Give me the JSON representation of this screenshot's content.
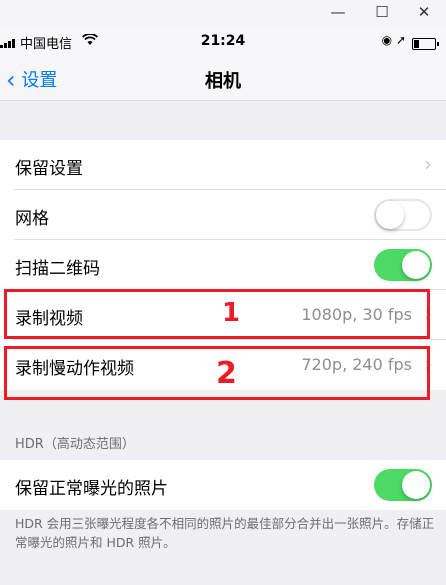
{
  "window": {
    "minimize": "—",
    "maximize": "☐",
    "close": "✕"
  },
  "status": {
    "carrier": "中国电信",
    "time": "21:24",
    "icons": "◉ ➚"
  },
  "nav": {
    "back_label": "设置",
    "title": "相机"
  },
  "group1": [
    {
      "label": "保留设置",
      "type": "link"
    },
    {
      "label": "网格",
      "type": "toggle",
      "on": false
    },
    {
      "label": "扫描二维码",
      "type": "toggle",
      "on": true
    },
    {
      "label": "录制视频",
      "type": "link",
      "detail": "1080p, 30 fps"
    },
    {
      "label": "录制慢动作视频",
      "type": "link",
      "detail": "720p, 240 fps"
    }
  ],
  "annotations": [
    "1",
    "2"
  ],
  "hdr_section": {
    "header": "HDR（高动态范围）",
    "row": {
      "label": "保留正常曝光的照片",
      "on": true
    },
    "footer": "HDR 会用三张曝光程度各不相同的照片的最佳部分合并出一张照片。存储正常曝光的照片和 HDR 照片。"
  },
  "colors": {
    "accent": "#007aff",
    "toggle_on": "#4cd964",
    "annotation": "#ed1c24"
  }
}
